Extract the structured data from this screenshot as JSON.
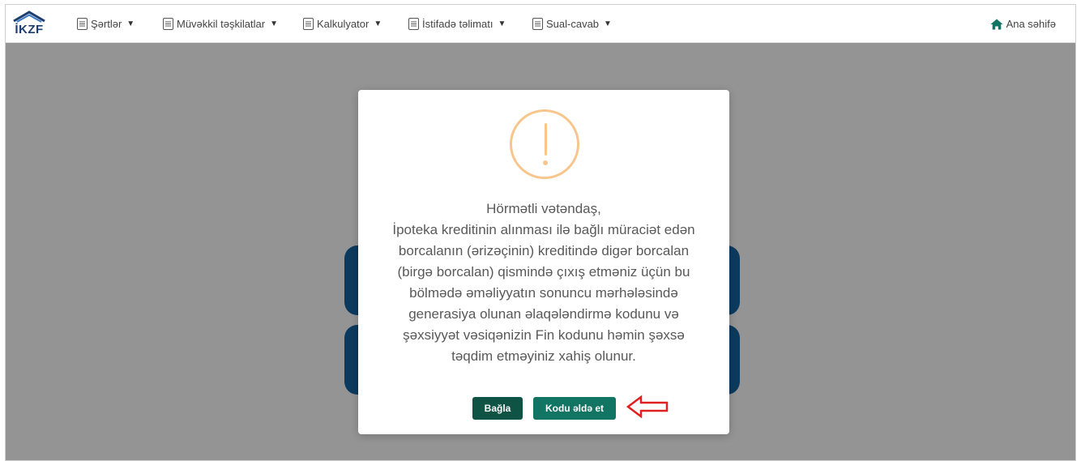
{
  "brand": {
    "logo_text": "İKZF"
  },
  "nav": {
    "items": [
      {
        "label": "Şərtlər"
      },
      {
        "label": "Müvəkkil təşkilatlar"
      },
      {
        "label": "Kalkulyator"
      },
      {
        "label": "İstifadə təlimatı"
      },
      {
        "label": "Sual-cavab"
      }
    ],
    "home_label": "Ana səhifə"
  },
  "modal": {
    "icon": "exclamation-circle-icon",
    "lines": [
      "Hörmətli vətəndaş,",
      "İpoteka kreditinin alınması ilə bağlı müraciət edən",
      "borcalanın (ərizəçinin) kreditində digər borcalan",
      "(birgə borcalan) qismində çıxış etməniz üçün bu",
      "bölmədə əməliyyatın sonuncu mərhələsində",
      "generasiya olunan əlaqələndirmə kodunu və",
      "şəxsiyyət vəsiqənizin Fin kodunu həmin şəxsə",
      "təqdim etməyiniz xahiş olunur."
    ],
    "close_label": "Bağla",
    "get_code_label": "Kodu əldə et"
  },
  "colors": {
    "brand_blue": "#1d3e6e",
    "warning": "#f8c58c",
    "close_button": "#0e5344",
    "code_button": "#127564",
    "annotation_arrow": "#e02020"
  }
}
